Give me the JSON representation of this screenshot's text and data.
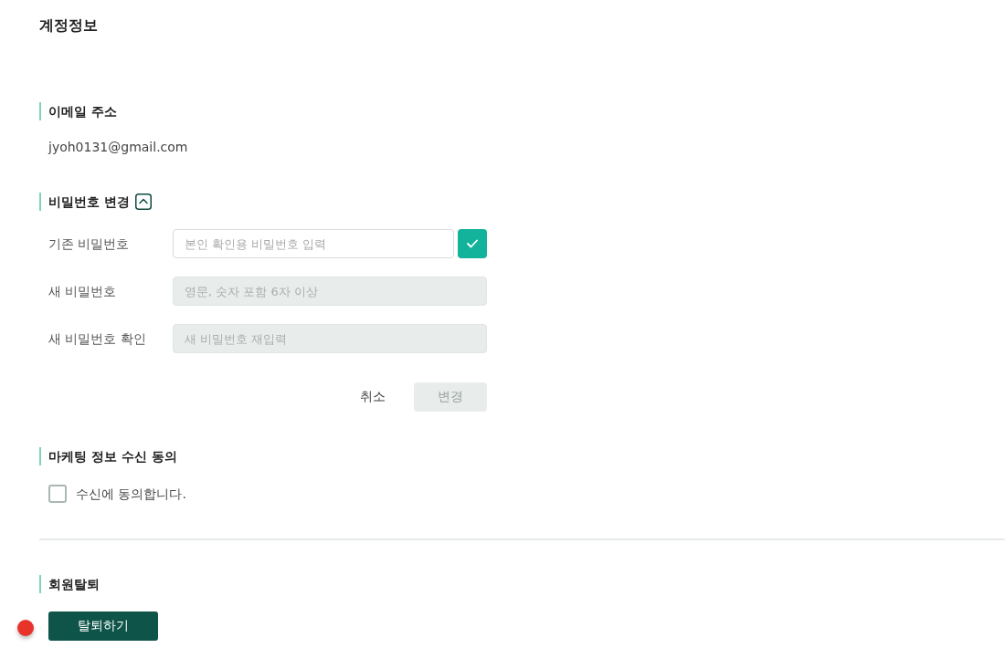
{
  "page_title": "계정정보",
  "email_section": {
    "title": "이메일 주소",
    "value": "jyoh0131@gmail.com"
  },
  "password_section": {
    "title": "비밀번호 변경",
    "expanded": true,
    "fields": [
      {
        "label": "기존 비밀번호",
        "placeholder": "본인 확인용 비밀번호 입력",
        "kind": "verify",
        "disabled": false
      },
      {
        "label": "새 비밀번호",
        "placeholder": "영문, 숫자 포함 6자 이상",
        "kind": "plain",
        "disabled": true
      },
      {
        "label": "새 비밀번호 확인",
        "placeholder": "새 비밀번호 재입력",
        "kind": "plain",
        "disabled": true
      }
    ],
    "buttons": [
      {
        "label": "취소",
        "kind": "text",
        "disabled": false
      },
      {
        "label": "변경",
        "kind": "filled",
        "disabled": true
      }
    ]
  },
  "marketing_section": {
    "title": "마케팅 정보 수신 동의",
    "consent": {
      "label": "수신에 동의합니다.",
      "checked": false
    }
  },
  "withdrawal_section": {
    "title": "회원탈퇴",
    "button": "탈퇴하기"
  }
}
